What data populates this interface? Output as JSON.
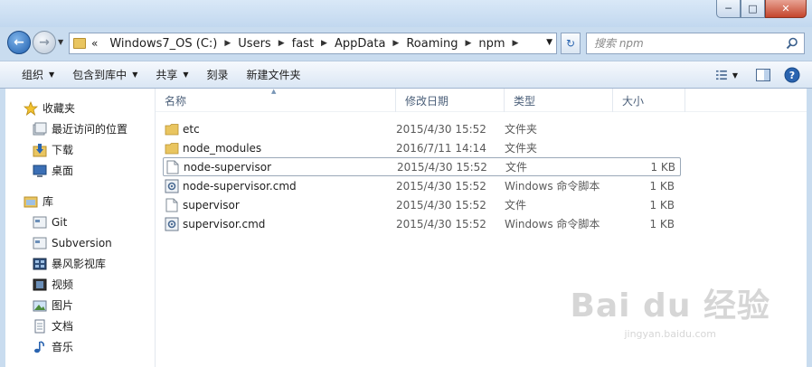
{
  "address": {
    "lead": "«",
    "crumbs": [
      "Windows7_OS (C:)",
      "Users",
      "fast",
      "AppData",
      "Roaming",
      "npm"
    ]
  },
  "search": {
    "placeholder": "搜索 npm"
  },
  "toolbar": {
    "organize": "组织",
    "include": "包含到库中",
    "share": "共享",
    "burn": "刻录",
    "new_folder": "新建文件夹"
  },
  "nav": {
    "favorites": {
      "label": "收藏夹",
      "items": [
        "最近访问的位置",
        "下载",
        "桌面"
      ]
    },
    "libraries": {
      "label": "库",
      "items": [
        "Git",
        "Subversion",
        "暴风影视库",
        "视频",
        "图片",
        "文档",
        "音乐"
      ]
    }
  },
  "columns": {
    "name": "名称",
    "date": "修改日期",
    "type": "类型",
    "size": "大小"
  },
  "files": [
    {
      "name": "etc",
      "date": "2015/4/30 15:52",
      "type": "文件夹",
      "size": "",
      "icon": "folder-icon"
    },
    {
      "name": "node_modules",
      "date": "2016/7/11 14:14",
      "type": "文件夹",
      "size": "",
      "icon": "folder-icon"
    },
    {
      "name": "node-supervisor",
      "date": "2015/4/30 15:52",
      "type": "文件",
      "size": "1 KB",
      "icon": "file-icon"
    },
    {
      "name": "node-supervisor.cmd",
      "date": "2015/4/30 15:52",
      "type": "Windows 命令脚本",
      "size": "1 KB",
      "icon": "cmd-script-icon"
    },
    {
      "name": "supervisor",
      "date": "2015/4/30 15:52",
      "type": "文件",
      "size": "1 KB",
      "icon": "file-icon"
    },
    {
      "name": "supervisor.cmd",
      "date": "2015/4/30 15:52",
      "type": "Windows 命令脚本",
      "size": "1 KB",
      "icon": "cmd-script-icon"
    }
  ],
  "watermark": {
    "main": "Bai du 经验",
    "sub": "jingyan.baidu.com"
  },
  "colors": {
    "folder": "#e9c560",
    "selection_border": "#9aa8b8",
    "accent": "#2a64b0"
  }
}
